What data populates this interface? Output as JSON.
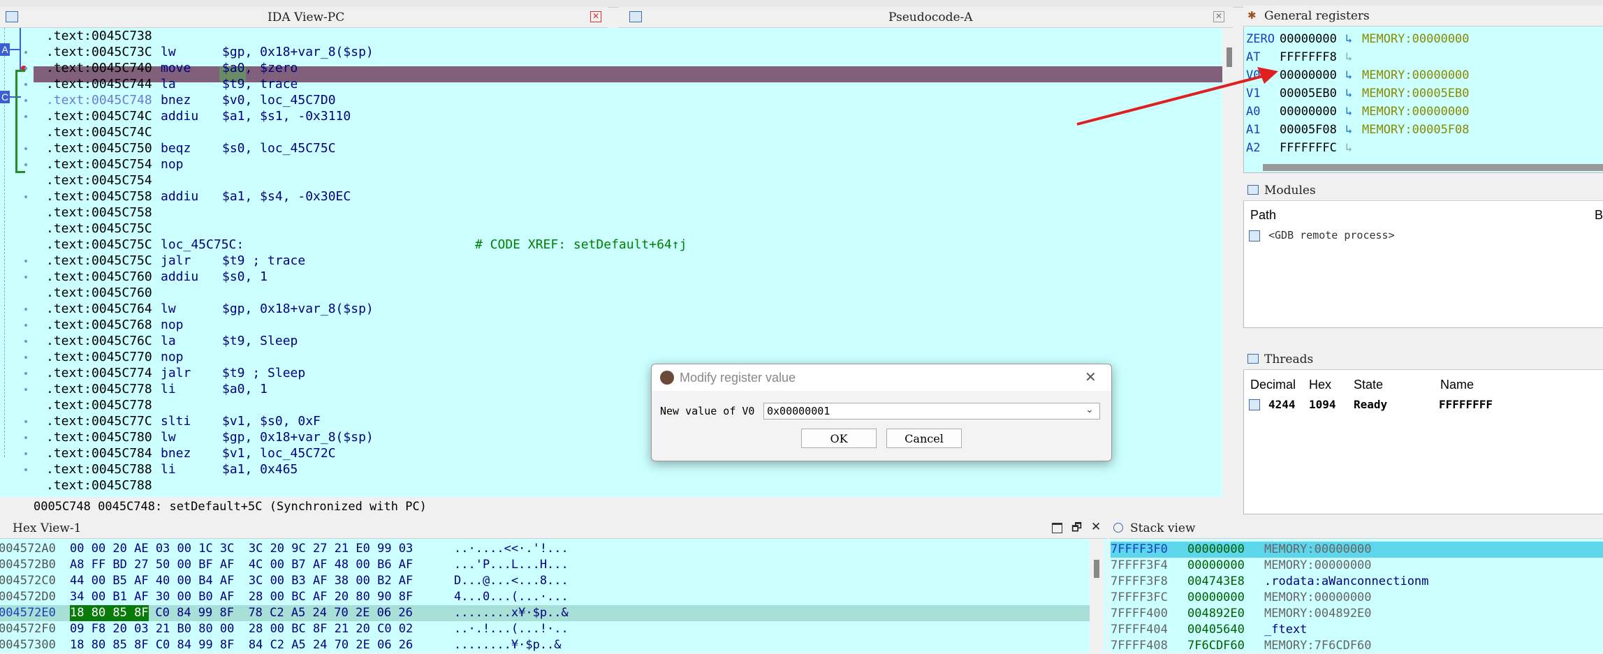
{
  "ida_view": {
    "title": "IDA View-PC",
    "lines": [
      {
        "addr": ".text:0045C738",
        "mn": "",
        "ops": ""
      },
      {
        "addr": ".text:0045C73C",
        "mn": "lw",
        "ops": "$gp, 0x18+var_8($sp)"
      },
      {
        "addr": ".text:0045C740",
        "mn": "move",
        "ops": "$a0, $zero"
      },
      {
        "addr": ".text:0045C744",
        "mn": "la",
        "ops": "$t9, trace"
      },
      {
        "addr": ".text:0045C748",
        "mn": "bnez",
        "ops": "$v0, loc_45C7D0"
      },
      {
        "addr": ".text:0045C74C",
        "mn": "addiu",
        "ops": "$a1, $s1, -0x3110"
      },
      {
        "addr": ".text:0045C74C",
        "mn": "",
        "ops": ""
      },
      {
        "addr": ".text:0045C750",
        "mn": "beqz",
        "ops": "$s0, loc_45C75C"
      },
      {
        "addr": ".text:0045C754",
        "mn": "nop",
        "ops": ""
      },
      {
        "addr": ".text:0045C754",
        "mn": "",
        "ops": ""
      },
      {
        "addr": ".text:0045C758",
        "mn": "addiu",
        "ops": "$a1, $s4, -0x30EC"
      },
      {
        "addr": ".text:0045C758",
        "mn": "",
        "ops": ""
      },
      {
        "addr": ".text:0045C75C",
        "mn": "",
        "ops": ""
      },
      {
        "addr": ".text:0045C75C",
        "mn": "loc_45C75C:",
        "ops": "",
        "xref": "# CODE XREF: setDefault+64↑j"
      },
      {
        "addr": ".text:0045C75C",
        "mn": "jalr",
        "ops": "$t9 ; trace"
      },
      {
        "addr": ".text:0045C760",
        "mn": "addiu",
        "ops": "$s0, 1"
      },
      {
        "addr": ".text:0045C760",
        "mn": "",
        "ops": ""
      },
      {
        "addr": ".text:0045C764",
        "mn": "lw",
        "ops": "$gp, 0x18+var_8($sp)"
      },
      {
        "addr": ".text:0045C768",
        "mn": "nop",
        "ops": ""
      },
      {
        "addr": ".text:0045C76C",
        "mn": "la",
        "ops": "$t9, Sleep"
      },
      {
        "addr": ".text:0045C770",
        "mn": "nop",
        "ops": ""
      },
      {
        "addr": ".text:0045C774",
        "mn": "jalr",
        "ops": "$t9 ; Sleep"
      },
      {
        "addr": ".text:0045C778",
        "mn": "li",
        "ops": "$a0, 1"
      },
      {
        "addr": ".text:0045C778",
        "mn": "",
        "ops": ""
      },
      {
        "addr": ".text:0045C77C",
        "mn": "slti",
        "ops": "$v1, $s0, 0xF"
      },
      {
        "addr": ".text:0045C780",
        "mn": "lw",
        "ops": "$gp, 0x18+var_8($sp)"
      },
      {
        "addr": ".text:0045C784",
        "mn": "bnez",
        "ops": "$v1, loc_45C72C"
      },
      {
        "addr": ".text:0045C788",
        "mn": "li",
        "ops": "$a1, 0x465"
      },
      {
        "addr": ".text:0045C788",
        "mn": "",
        "ops": ""
      }
    ],
    "status": "0005C748 0045C748: setDefault+5C (Synchronized with PC)"
  },
  "pseudocode": {
    "title": "Pseudocode-A"
  },
  "registers": {
    "title": "General registers",
    "rows": [
      {
        "name": "ZERO",
        "value": "00000000",
        "target": "MEMORY:00000000"
      },
      {
        "name": "AT",
        "value": "FFFFFFF8",
        "target": ""
      },
      {
        "name": "V0",
        "value": "00000000",
        "target": "MEMORY:00000000"
      },
      {
        "name": "V1",
        "value": "00005EB0",
        "target": "MEMORY:00005EB0"
      },
      {
        "name": "A0",
        "value": "00000000",
        "target": "MEMORY:00000000"
      },
      {
        "name": "A1",
        "value": "00005F08",
        "target": "MEMORY:00005F08"
      },
      {
        "name": "A2",
        "value": "FFFFFFFC",
        "target": ""
      }
    ]
  },
  "modules": {
    "title": "Modules",
    "col_path": "Path",
    "col_b": "B",
    "item": "<GDB remote process>"
  },
  "threads": {
    "title": "Threads",
    "cols": [
      "Decimal",
      "Hex",
      "State",
      "Name"
    ],
    "row": {
      "decimal": "4244",
      "hex": "1094",
      "state": "Ready",
      "name": "FFFFFFFF"
    }
  },
  "dialog": {
    "title": "Modify register value",
    "label": "New value of V0",
    "value": "0x00000001",
    "ok": "OK",
    "cancel": "Cancel"
  },
  "hex_view": {
    "title": "Hex View-1",
    "rows": [
      {
        "addr": "004572A0",
        "bytes": "00 00 20 AE 03 00 1C 3C  3C 20 9C 27 21 E0 99 03",
        "ascii": "..·....<<·.'!..."
      },
      {
        "addr": "004572B0",
        "bytes": "A8 FF BD 27 50 00 BF AF  4C 00 B7 AF 48 00 B6 AF",
        "ascii": "...'P...L...H..."
      },
      {
        "addr": "004572C0",
        "bytes": "44 00 B5 AF 40 00 B4 AF  3C 00 B3 AF 38 00 B2 AF",
        "ascii": "D...@...<...8..."
      },
      {
        "addr": "004572D0",
        "bytes": "34 00 B1 AF 30 00 B0 AF  28 00 BC AF 20 80 90 8F",
        "ascii": "4...0...(...·..."
      },
      {
        "addr": "004572E0",
        "bytes": "C0 84 99 8F  78 C2 A5 24 70 2E 06 26",
        "hlbytes": "18 80 85 8F",
        "ascii": "........x¥·$p..&"
      },
      {
        "addr": "004572F0",
        "bytes": "09 F8 20 03 21 B0 80 00  28 00 BC 8F 21 20 C0 02",
        "ascii": "..·.!...(...!·.."
      },
      {
        "addr": "00457300",
        "bytes": "18 80 85 8F C0 84 99 8F  84 C2 A5 24 70 2E 06 26",
        "ascii": "........¥·$p..&"
      }
    ]
  },
  "stack_view": {
    "title": "Stack view",
    "rows": [
      {
        "addr": "7FFFF3F0",
        "value": "00000000",
        "target": "MEMORY:00000000"
      },
      {
        "addr": "7FFFF3F4",
        "value": "00000000",
        "target": "MEMORY:00000000"
      },
      {
        "addr": "7FFFF3F8",
        "value": "004743E8",
        "target": ".rodata:aWanconnectionm"
      },
      {
        "addr": "7FFFF3FC",
        "value": "00000000",
        "target": "MEMORY:00000000"
      },
      {
        "addr": "7FFFF400",
        "value": "004892E0",
        "target": "MEMORY:004892E0"
      },
      {
        "addr": "7FFFF404",
        "value": "00405640",
        "target": "_ftext"
      },
      {
        "addr": "7FFFF408",
        "value": "7F6CDF60",
        "target": "MEMORY:7F6CDF60"
      }
    ]
  },
  "gutter_labels": {
    "a": "A",
    "c": "C"
  },
  "colors": {
    "ida_bg": "#ccffff",
    "highlight": "#7f5f7a",
    "arrow": "#e02020"
  }
}
